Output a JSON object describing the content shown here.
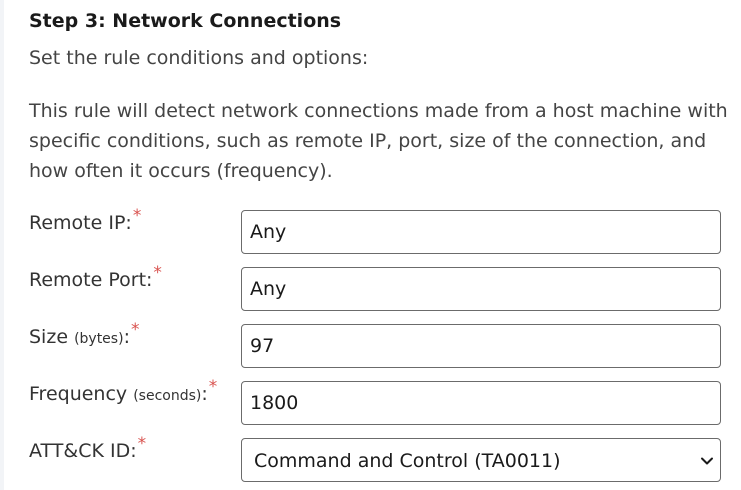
{
  "step": {
    "title": "Step 3: Network Connections",
    "subtitle": "Set the rule conditions and options:",
    "description": "This rule will detect network connections made from a host machine with specific conditions, such as remote IP, port, size of the connection, and how often it occurs (frequency)."
  },
  "form": {
    "required_marker": "*",
    "remote_ip": {
      "label": "Remote IP:",
      "value": "Any"
    },
    "remote_port": {
      "label": "Remote Port:",
      "value": "Any"
    },
    "size": {
      "label": "Size",
      "hint": "(bytes)",
      "suffix": ":",
      "value": "97"
    },
    "frequency": {
      "label": "Frequency",
      "hint": "(seconds)",
      "suffix": ":",
      "value": "1800"
    },
    "attck_id": {
      "label": "ATT&CK ID:",
      "selected": "Command and Control (TA0011)",
      "icon": "chevron-down-icon"
    }
  }
}
